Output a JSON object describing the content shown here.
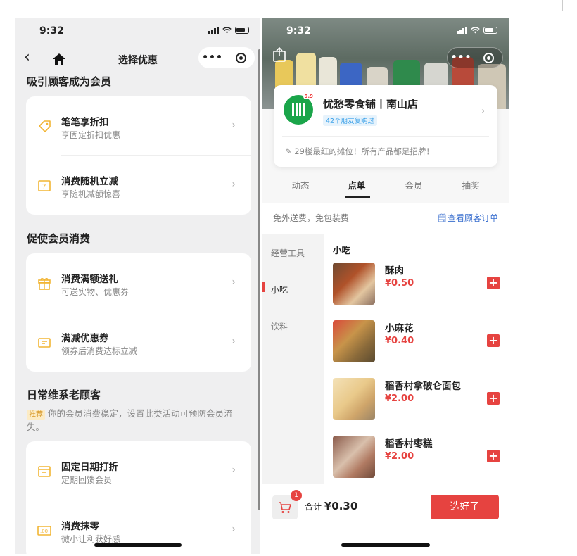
{
  "left": {
    "status": {
      "time": "9:32"
    },
    "nav": {
      "title": "选择优惠",
      "more": "•••"
    },
    "sections": [
      {
        "title": "吸引顾客成为会员",
        "items": [
          {
            "title": "笔笔享折扣",
            "sub": "享固定折扣优惠",
            "icon": "tag-icon"
          },
          {
            "title": "消费随机立减",
            "sub": "享随机减额惊喜",
            "icon": "random-discount-icon"
          }
        ]
      },
      {
        "title": "促使会员消费",
        "items": [
          {
            "title": "消费满额送礼",
            "sub": "可送实物、优惠券",
            "icon": "gift-icon"
          },
          {
            "title": "满减优惠券",
            "sub": "领券后消费达标立减",
            "icon": "coupon-icon"
          }
        ]
      },
      {
        "title": "日常维系老顾客",
        "recommend_tag": "推荐",
        "recommend_text": "你的会员消费稳定，设置此类活动可预防会员流失。",
        "items": [
          {
            "title": "固定日期打折",
            "sub": "定期回馈会员",
            "icon": "calendar-icon"
          },
          {
            "title": "消费抹零",
            "sub": "微小让利获好感",
            "icon": "round-off-icon"
          }
        ]
      }
    ]
  },
  "right": {
    "status": {
      "time": "9:32"
    },
    "store": {
      "name": "忧愁零食铺丨南山店",
      "friends": "42个朋友复购过",
      "desc": "29楼最红的摊位！所有产品都是招牌！",
      "logo_badge": "9.9"
    },
    "tabs": [
      "动态",
      "点单",
      "会员",
      "抽奖"
    ],
    "active_tab": "点单",
    "notice": {
      "left": "免外送费，免包装费",
      "right": "查看顾客订单"
    },
    "categories": [
      "经营工具",
      "小吃",
      "饮料"
    ],
    "active_category": "小吃",
    "menu_header": "小吃",
    "products": [
      {
        "name": "酥肉",
        "price": "¥0.50"
      },
      {
        "name": "小麻花",
        "price": "¥0.40"
      },
      {
        "name": "稻香村拿破仑面包",
        "price": "¥2.00"
      },
      {
        "name": "稻香村枣糕",
        "price": "¥2.00"
      }
    ],
    "cart": {
      "count": "1",
      "total_label": "合计",
      "total": "¥0.30",
      "submit": "选好了"
    }
  },
  "colors": {
    "accent": "#e64340",
    "icon_yellow": "#f2b534",
    "link_blue": "#3a6fcf"
  }
}
